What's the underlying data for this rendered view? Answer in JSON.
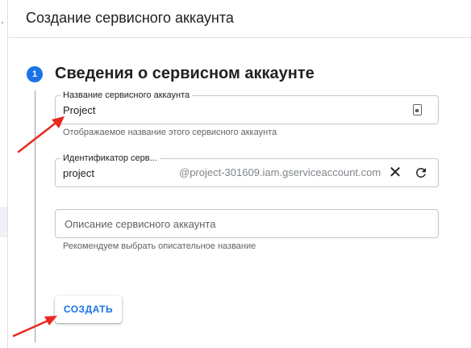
{
  "left_strip": {
    "glyph": "."
  },
  "header": {
    "title": "Создание сервисного аккаунта"
  },
  "step": {
    "number": "1",
    "title": "Сведения о сервисном аккаунте"
  },
  "name_field": {
    "label": "Название сервисного аккаунта",
    "value": "Project",
    "hint": "Отображаемое название этого сервисного аккаунта",
    "icon": "badge-icon"
  },
  "id_field": {
    "label": "Идентификатор серв...",
    "value": "project",
    "suffix": "@project-301609.iam.gserviceaccount.com",
    "clear_icon": "close-icon",
    "refresh_icon": "refresh-icon"
  },
  "description_field": {
    "placeholder": "Описание сервисного аккаунта",
    "hint": "Рекомендуем выбрать описательное название"
  },
  "create_button": {
    "label": "СОЗДАТЬ"
  },
  "colors": {
    "accent": "#1a73e8",
    "annotation_arrow": "#e8291f"
  }
}
